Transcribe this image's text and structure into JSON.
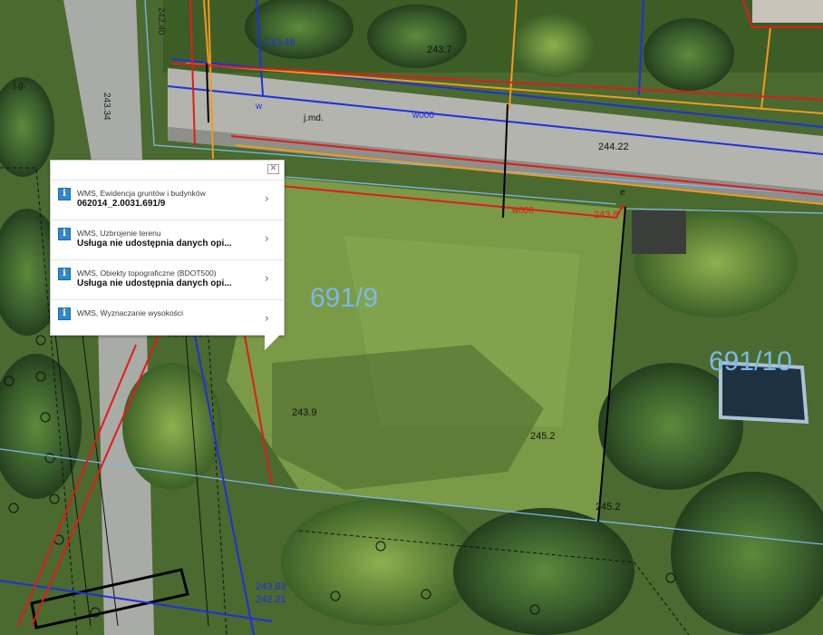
{
  "map": {
    "parcel_labels": [
      "691/9",
      "691/10"
    ],
    "elevations": [
      "242.40",
      "243.48",
      "243.7",
      "243.34",
      "244.22",
      "243.8",
      "243.9",
      "245.2",
      "245.2",
      "243.83",
      "242.21"
    ],
    "land_use_labels": [
      "j.g.",
      "j.md."
    ],
    "line_codes": [
      "w",
      "w000",
      "w000",
      "e"
    ],
    "colors": {
      "parcel_boundary": "#7db8e8",
      "utility_red": "#e11b1b",
      "utility_orange": "#f29a1e",
      "utility_blue": "#1f2fe0",
      "building": "#000000"
    }
  },
  "popup": {
    "close_icon": "close-icon",
    "items": [
      {
        "title": "WMS, Ewidencja gruntów i budynków",
        "value": "062014_2.0031.691/9"
      },
      {
        "title": "WMS, Uzbrojenie terenu",
        "value": "Usługa nie udostępnia danych opi..."
      },
      {
        "title": "WMS, Obiekty topograficzne (BDOT500)",
        "value": "Usługa nie udostępnia danych opi..."
      },
      {
        "title": "WMS, Wyznaczanie wysokości",
        "value": ""
      }
    ]
  }
}
